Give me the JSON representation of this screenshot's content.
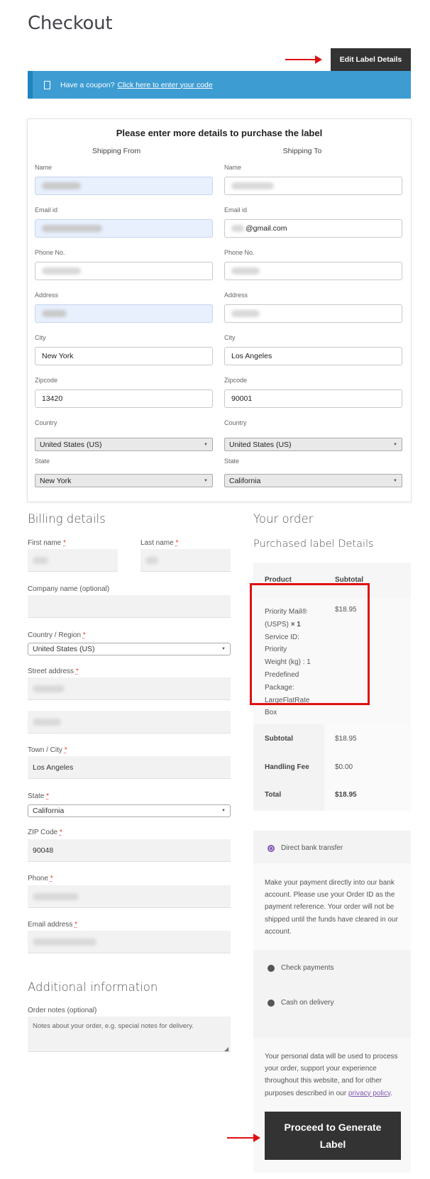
{
  "page": {
    "title": "Checkout"
  },
  "toolbar": {
    "edit_label_details": "Edit Label Details"
  },
  "coupon": {
    "text": "Have a coupon?",
    "link": "Click here to enter your code"
  },
  "label_card": {
    "title": "Please enter more details to purchase the label",
    "from_heading": "Shipping From",
    "to_heading": "Shipping To",
    "labels": {
      "name": "Name",
      "email": "Email id",
      "phone": "Phone No.",
      "address": "Address",
      "city": "City",
      "zip": "Zipcode",
      "country": "Country",
      "state": "State"
    },
    "from": {
      "city": "New York",
      "zip": "13420",
      "country": "United States (US)",
      "state": "New York"
    },
    "to": {
      "email_suffix": "@gmail.com",
      "city": "Los Angeles",
      "zip": "90001",
      "country": "United States (US)",
      "state": "California"
    }
  },
  "billing": {
    "heading": "Billing details",
    "first_name_label": "First name",
    "last_name_label": "Last name",
    "company_label": "Company name (optional)",
    "country_label": "Country / Region",
    "country_value": "United States (US)",
    "street_label": "Street address",
    "city_label": "Town / City",
    "city_value": "Los Angeles",
    "state_label": "State",
    "state_value": "California",
    "zip_label": "ZIP Code",
    "zip_value": "90048",
    "phone_label": "Phone",
    "email_label": "Email address",
    "required_mark": "*"
  },
  "additional": {
    "heading": "Additional information",
    "notes_label": "Order notes (optional)",
    "notes_placeholder": "Notes about your order, e.g. special notes for delivery."
  },
  "order": {
    "heading": "Your order",
    "subheading": "Purchased label Details",
    "col_product": "Product",
    "col_subtotal": "Subtotal",
    "item_lines": [
      "Priority Mail®",
      "(USPS)",
      "× 1",
      "Service ID:",
      "Priority",
      "Weight (kg) : 1",
      "Predefined",
      "Package:",
      "LargeFlatRate",
      "Box"
    ],
    "item_price": "$18.95",
    "rows": [
      {
        "label": "Subtotal",
        "value": "$18.95"
      },
      {
        "label": "Handling Fee",
        "value": "$0.00"
      },
      {
        "label": "Total",
        "value": "$18.95"
      }
    ]
  },
  "payment": {
    "methods": [
      "Direct bank transfer",
      "Check payments",
      "Cash on delivery"
    ],
    "selected": "Direct bank transfer",
    "description": "Make your payment directly into our bank account. Please use your Order ID as the payment reference. Your order will not be shipped until the funds have cleared in our account.",
    "privacy_text": "Your personal data will be used to process your order, support your experience throughout this website, and for other purposes described in our",
    "privacy_link": "privacy policy",
    "proceed_label": "Proceed to Generate Label"
  },
  "colors": {
    "accent_blue": "#3d9cd2",
    "button_dark": "#333333",
    "annotation_red": "#e01010",
    "radio_purple": "#7f54b3"
  }
}
